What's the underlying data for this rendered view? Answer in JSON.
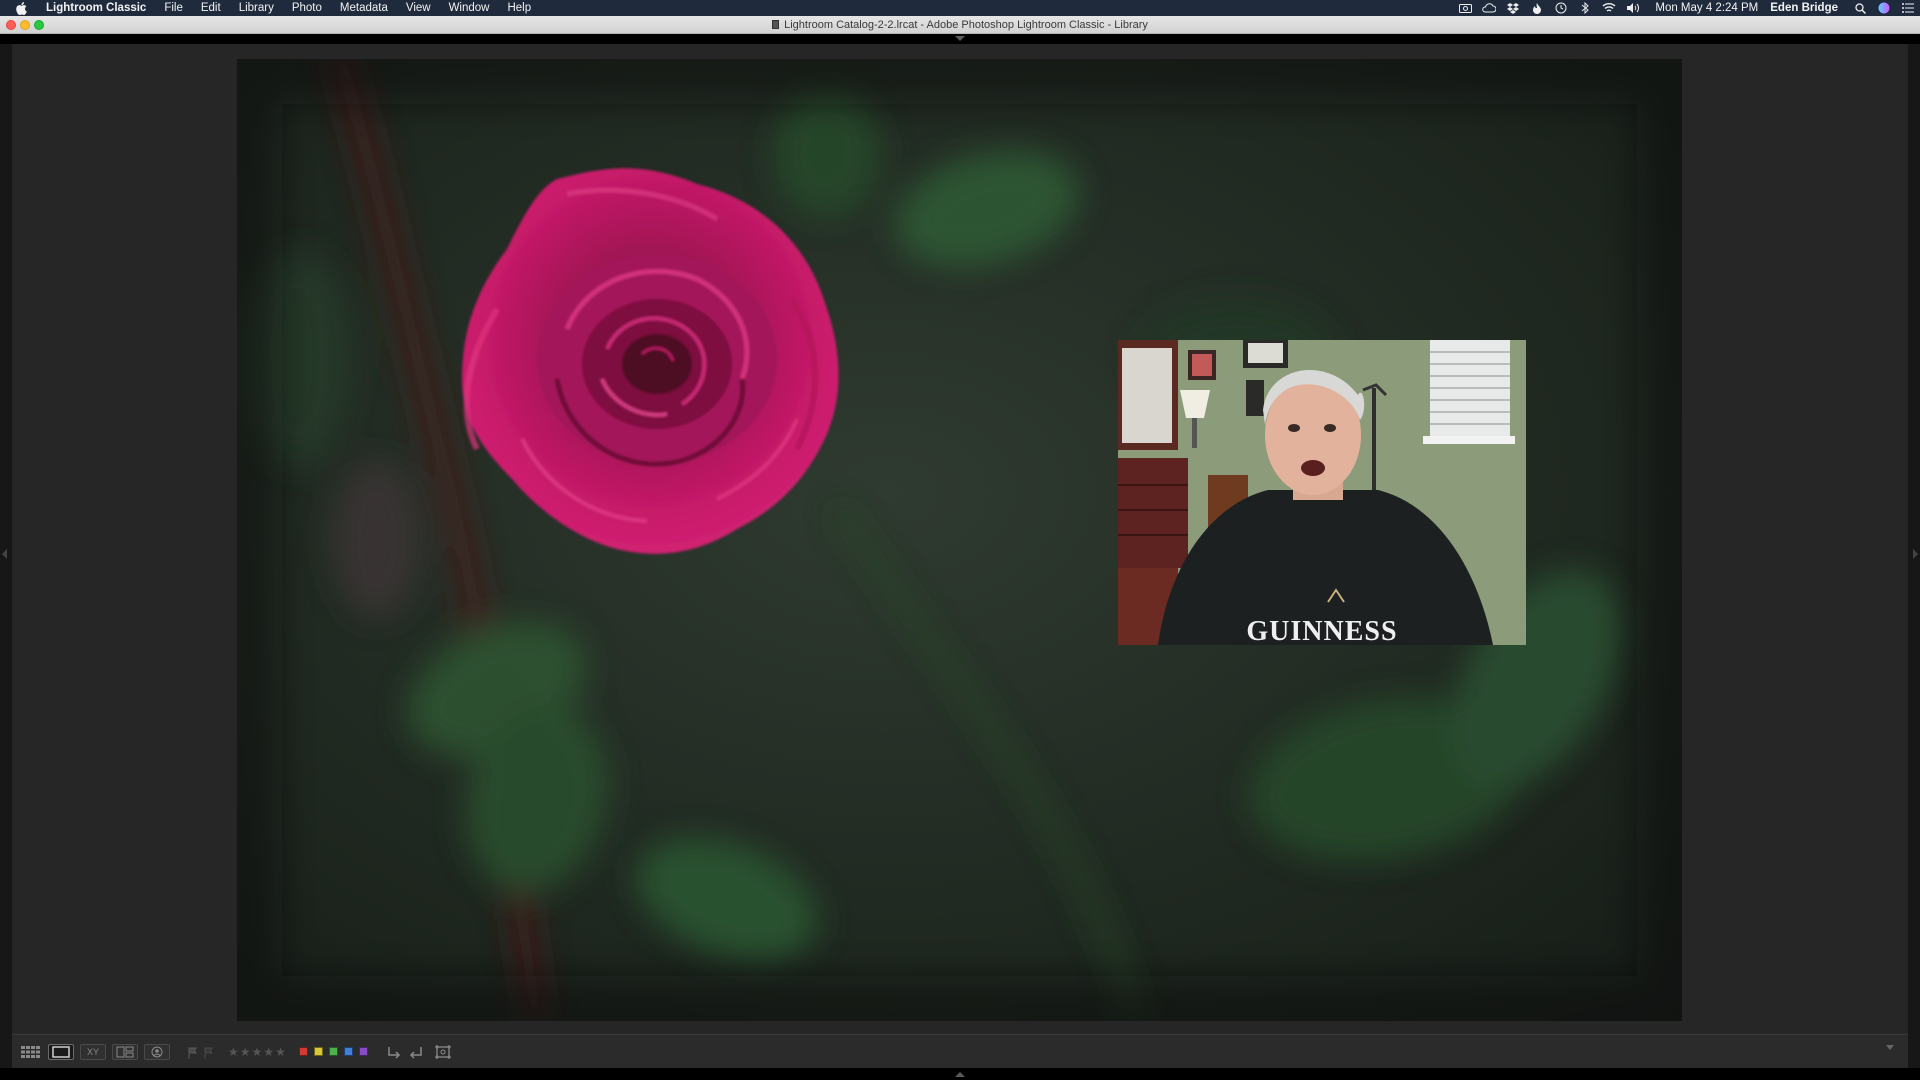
{
  "menubar": {
    "apple_icon": "apple-icon",
    "items": [
      {
        "label": "Lightroom Classic"
      },
      {
        "label": "File"
      },
      {
        "label": "Edit"
      },
      {
        "label": "Library"
      },
      {
        "label": "Photo"
      },
      {
        "label": "Metadata"
      },
      {
        "label": "View"
      },
      {
        "label": "Window"
      },
      {
        "label": "Help"
      }
    ],
    "status_icons": [
      "camera-icon",
      "creative-cloud-icon",
      "dropbox-icon",
      "flame-icon",
      "time-machine-icon",
      "bluetooth-icon",
      "wifi-icon",
      "volume-icon"
    ],
    "clock": "Mon May 4  2:24 PM",
    "user": "Eden Bridge",
    "end_icons": [
      "spotlight-search-icon",
      "siri-icon",
      "notification-center-icon"
    ]
  },
  "window": {
    "title": "Lightroom Catalog-2-2.lrcat - Adobe Photoshop Lightroom Classic - Library"
  },
  "webcam": {
    "shirt_text": "GUINNESS"
  },
  "toolbar": {
    "view_modes": [
      {
        "name": "grid-view-button",
        "icon": "grid-icon"
      },
      {
        "name": "loupe-view-button",
        "icon": "loupe-icon"
      },
      {
        "name": "compare-view-button",
        "label": "XY"
      },
      {
        "name": "survey-view-button",
        "icon": "survey-icon"
      },
      {
        "name": "people-view-button",
        "icon": "people-icon"
      }
    ],
    "active_view": "loupe",
    "star_rating": 0,
    "color_labels": [
      "#d33a34",
      "#d8c836",
      "#4cb34a",
      "#3f7fd6",
      "#8a4bc8"
    ],
    "accent": "#262626"
  }
}
